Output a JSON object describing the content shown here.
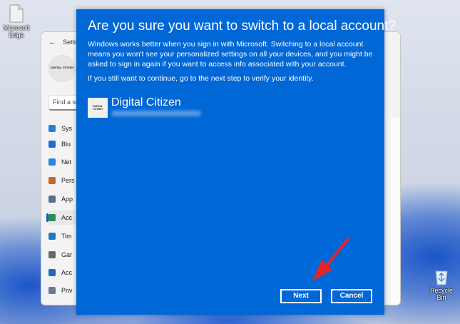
{
  "desktop": {
    "edge_icon_label": "Microsoft Edge",
    "recycle_bin_label": "Recycle Bin"
  },
  "settings_window": {
    "title": "Settings",
    "avatar_text": "DIGITAL CITIZEN",
    "search_placeholder": "Find a se",
    "nav_items": [
      {
        "label": "Sys",
        "icon": "system-icon",
        "color": "#2a7fd4"
      },
      {
        "label": "Blu",
        "icon": "bluetooth-icon",
        "color": "#1a6fd0"
      },
      {
        "label": "Net",
        "icon": "network-icon",
        "color": "#2a86e0"
      },
      {
        "label": "Pers",
        "icon": "personalization-icon",
        "color": "#c46a2a"
      },
      {
        "label": "App",
        "icon": "apps-icon",
        "color": "#5a6f8c"
      },
      {
        "label": "Acc",
        "icon": "accounts-icon",
        "color": "#2f8a56",
        "active": true
      },
      {
        "label": "Tim",
        "icon": "time-icon",
        "color": "#1f7cc4"
      },
      {
        "label": "Gar",
        "icon": "gaming-icon",
        "color": "#6a6a6a"
      },
      {
        "label": "Acc",
        "icon": "accessibility-icon",
        "color": "#1f6bc4"
      },
      {
        "label": "Priv",
        "icon": "privacy-icon",
        "color": "#6f7a88"
      }
    ]
  },
  "dialog": {
    "title": "Are you sure you want to switch to a local account?",
    "paragraph1": "Windows works better when you sign in with Microsoft. Switching to a local account means you won't see your personalized settings on all your devices, and you might be asked to sign in again if you want to access info associated with your account.",
    "paragraph2": "If you still want to continue, go to the next step to verify your identity.",
    "account_name": "Digital Citizen",
    "account_pic_text": "DIGITAL CITIZEN",
    "next_label": "Next",
    "cancel_label": "Cancel",
    "background_color": "#0067d7",
    "annotation_arrow_color": "#e8232a"
  }
}
